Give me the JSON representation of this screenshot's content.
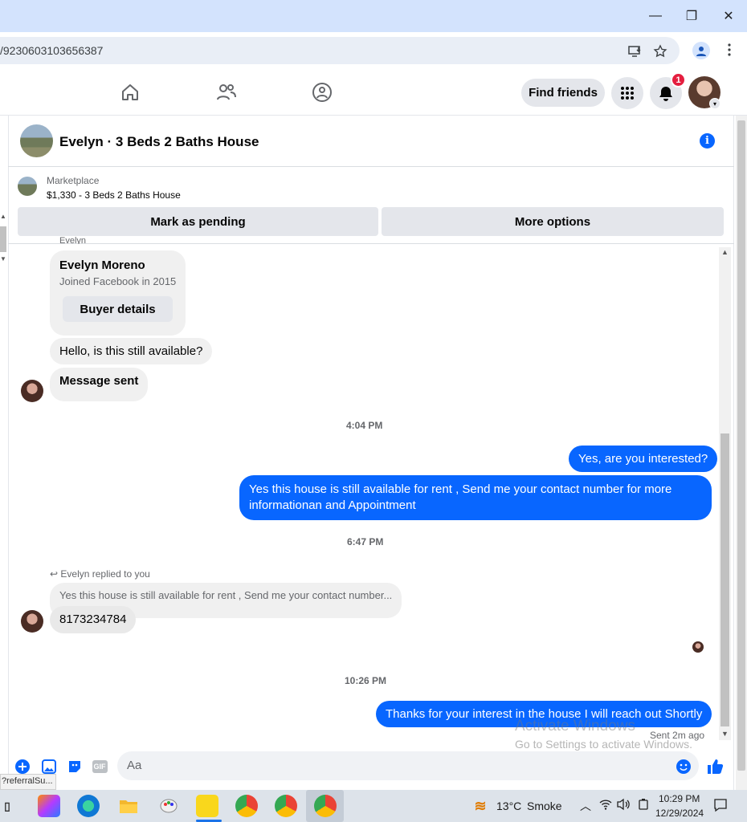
{
  "browser": {
    "url": "/9230603103656387",
    "window_controls": {
      "minimize": "—",
      "restore": "❐",
      "close": "✕"
    }
  },
  "header": {
    "find_friends_label": "Find friends",
    "notification_count": "1"
  },
  "chat": {
    "title": "Evelyn · 3 Beds 2 Baths House",
    "info_glyph": "i",
    "marketplace": {
      "label": "Marketplace",
      "listing": "$1,330 - 3 Beds 2 Baths House"
    },
    "actions": {
      "mark_pending": "Mark as pending",
      "more_options": "More options"
    },
    "cut_name": "Evelyn",
    "buyer_card": {
      "name": "Evelyn Moreno",
      "joined": "Joined Facebook in 2015",
      "button": "Buyer details"
    },
    "messages": {
      "in_1": "Hello, is this still available?",
      "in_2": "Message sent",
      "time_1": "4:04 PM",
      "out_1": "Yes, are you interested?",
      "out_2": "Yes this house is still available for rent , Send me your contact number for more informationan and Appointment",
      "time_2": "6:47 PM",
      "reply_note": "Evelyn replied to you",
      "reply_quote": "Yes this house is still available for rent , Send me your contact number...",
      "in_3": "8173234784",
      "time_3": "10:26 PM",
      "out_3": "Thanks for your interest in the house I will reach out Shortly",
      "sent_status": "Sent 2m ago"
    },
    "composer": {
      "placeholder": "Aa",
      "gif_label": "GIF"
    }
  },
  "watermark": {
    "line1": "Activate Windows",
    "line2": "Go to Settings to activate Windows."
  },
  "status_link": "?referralSu...",
  "taskbar": {
    "weather_temp": "13°C",
    "weather_desc": "Smoke",
    "time": "10:29 PM",
    "date": "12/29/2024"
  },
  "colors": {
    "messenger_blue": "#0866ff",
    "badge_red": "#e41e3f",
    "bubble_gray": "#f0f0f0"
  }
}
